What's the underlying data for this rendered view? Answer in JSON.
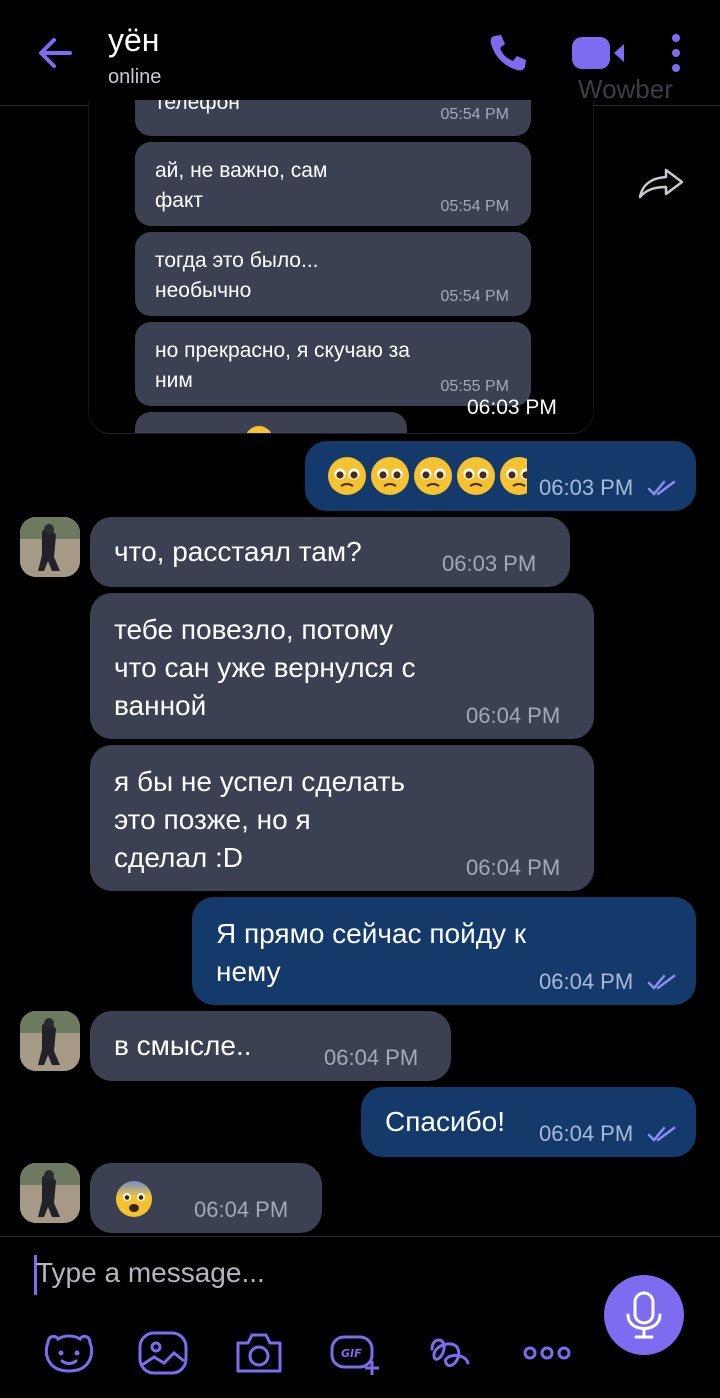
{
  "header": {
    "title": "уён",
    "status": "online",
    "watermark": "Wowber"
  },
  "quoted": {
    "messages": [
      {
        "text": "телефон",
        "time": "05:54 PM"
      },
      {
        "text": "ай, не важно, сам\nфакт",
        "time": "05:54 PM"
      },
      {
        "text": "тогда это было...\nнеобычно",
        "time": "05:54 PM"
      },
      {
        "text": "но прекрасно, я скучаю за\nним",
        "time": "05:55 PM"
      }
    ],
    "time": "06:03 PM"
  },
  "messages": [
    {
      "dir": "out",
      "text": "🥺🥺🥺🥺🥺",
      "time": "06:03 PM"
    },
    {
      "dir": "in",
      "text": "что, расстаял там?",
      "time": "06:03 PM"
    },
    {
      "dir": "in",
      "text": "тебе повезло, потому\nчто сан уже вернулся с\nванной",
      "time": "06:04 PM"
    },
    {
      "dir": "in",
      "text": "я бы не успел сделать\nэто позже, но я\nсделал :D",
      "time": "06:04 PM"
    },
    {
      "dir": "out",
      "text": "Я прямо сейчас пойду к\nнему",
      "time": "06:04 PM"
    },
    {
      "dir": "in",
      "text": "в смысле..",
      "time": "06:04 PM"
    },
    {
      "dir": "out",
      "text": "Спасибо!",
      "time": "06:04 PM"
    },
    {
      "dir": "in",
      "text": "😨",
      "time": "06:04 PM"
    }
  ],
  "composer": {
    "placeholder": "Type a message..."
  },
  "colors": {
    "accent": "#7d6cf0",
    "incoming_bubble": "#3b4152",
    "outgoing_bubble": "#143a6b",
    "background": "#000000"
  },
  "icons": [
    "back-arrow-icon",
    "phone-icon",
    "video-icon",
    "more-icon",
    "forward-icon",
    "read-ticks-icon",
    "sticker-icon",
    "gallery-icon",
    "camera-icon",
    "gif-icon",
    "doodle-icon",
    "more-options-icon",
    "microphone-icon"
  ]
}
